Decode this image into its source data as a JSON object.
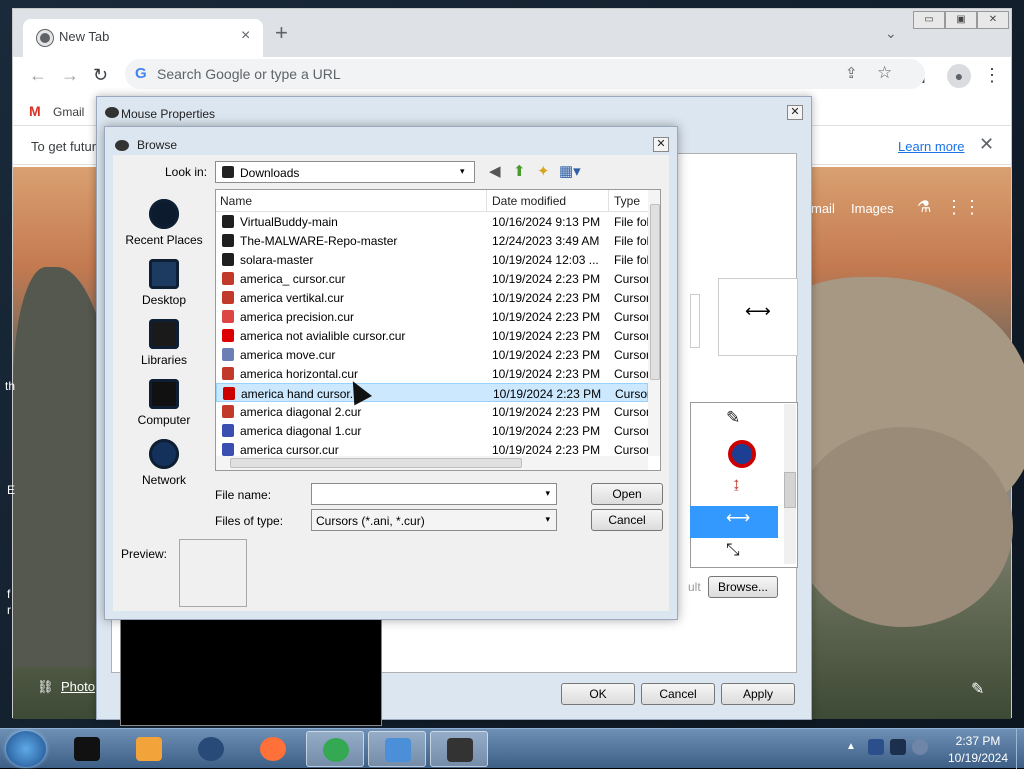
{
  "chrome": {
    "tab_title": "New Tab",
    "tab_close": "×",
    "new_tab": "+",
    "tab_search": "⌄",
    "window_buttons": {
      "minimize": "▭",
      "maximize": "▣",
      "close": "✕"
    },
    "back": "←",
    "forward": "→",
    "reload": "↻",
    "omnibox_placeholder": "Search Google or type a URL",
    "omnibox_g": "G",
    "share": "⇪",
    "star": "☆",
    "sidepanel": "▮",
    "profile": "●",
    "menu": "⋮",
    "bookmark_gmail_icon": "M",
    "bookmark_gmail": "Gmail",
    "infobar_text": "To get futur",
    "infobar_link": "Learn more",
    "infobar_close": "✕"
  },
  "ntp": {
    "gmail_link": "mail",
    "images_link": "Images",
    "flask": "⚗",
    "apps": "⋮⋮",
    "photo_link": "Photo",
    "photo_icon": "⛓",
    "edit": "✎",
    "left_fragments": [
      "th",
      "E",
      "f",
      "r"
    ]
  },
  "mouse_properties": {
    "title": "Mouse Properties",
    "close": "✕",
    "ok": "OK",
    "cancel": "Cancel",
    "apply": "Apply",
    "browse": "Browse...",
    "use_default_fragment": "ult",
    "cursor_preview_glyph": "⟷",
    "list_cursors": [
      "✎",
      "⃠",
      "↨",
      "⟷",
      "⤡"
    ]
  },
  "browse": {
    "title": "Browse",
    "close": "✕",
    "look_in_label": "Look in:",
    "look_in_value": "Downloads",
    "toolbar_icons": {
      "back": "◀",
      "up": "⬆",
      "new_folder": "✦",
      "views": "▦▾"
    },
    "places": [
      {
        "label": "Recent Places",
        "icon": "recent-places-icon"
      },
      {
        "label": "Desktop",
        "icon": "desktop-icon"
      },
      {
        "label": "Libraries",
        "icon": "libraries-icon"
      },
      {
        "label": "Computer",
        "icon": "computer-icon"
      },
      {
        "label": "Network",
        "icon": "network-icon"
      }
    ],
    "columns": [
      "Name",
      "Date modified",
      "Type"
    ],
    "files": [
      {
        "name": "VirtualBuddy-main",
        "date": "10/16/2024 9:13 PM",
        "type": "File fol",
        "icon": "folder",
        "color": "#1f1f1f"
      },
      {
        "name": "The-MALWARE-Repo-master",
        "date": "12/24/2023 3:49 AM",
        "type": "File fol",
        "icon": "folder",
        "color": "#1f1f1f"
      },
      {
        "name": "solara-master",
        "date": "10/19/2024 12:03 ...",
        "type": "File fol",
        "icon": "folder",
        "color": "#1f1f1f"
      },
      {
        "name": "america_ cursor.cur",
        "date": "10/19/2024 2:23 PM",
        "type": "Cursor",
        "icon": "cursor",
        "color": "#c0392b"
      },
      {
        "name": "america vertikal.cur",
        "date": "10/19/2024 2:23 PM",
        "type": "Cursor",
        "icon": "cursor",
        "color": "#c0392b"
      },
      {
        "name": "america precision.cur",
        "date": "10/19/2024 2:23 PM",
        "type": "Cursor",
        "icon": "cursor",
        "color": "#d44"
      },
      {
        "name": "america not avialible cursor.cur",
        "date": "10/19/2024 2:23 PM",
        "type": "Cursor",
        "icon": "cursor",
        "color": "#d00"
      },
      {
        "name": "america move.cur",
        "date": "10/19/2024 2:23 PM",
        "type": "Cursor",
        "icon": "cursor",
        "color": "#6b7fb5"
      },
      {
        "name": "america horizontal.cur",
        "date": "10/19/2024 2:23 PM",
        "type": "Cursor",
        "icon": "cursor",
        "color": "#c0392b"
      },
      {
        "name": "america hand cursor.",
        "date": "10/19/2024 2:23 PM",
        "type": "Cursor",
        "icon": "cursor",
        "color": "#c00"
      },
      {
        "name": "america diagonal 2.cur",
        "date": "10/19/2024 2:23 PM",
        "type": "Cursor",
        "icon": "cursor",
        "color": "#c0392b"
      },
      {
        "name": "america diagonal 1.cur",
        "date": "10/19/2024 2:23 PM",
        "type": "Cursor",
        "icon": "cursor",
        "color": "#3a4fb0"
      },
      {
        "name": "america cursor.cur",
        "date": "10/19/2024 2:23 PM",
        "type": "Cursor",
        "icon": "cursor",
        "color": "#3a4fb0"
      }
    ],
    "selected_row": "america hand cursor.",
    "file_name_label": "File name:",
    "file_name_value": "",
    "files_of_type_label": "Files of type:",
    "files_of_type_value": "Cursors (*.ani, *.cur)",
    "open": "Open",
    "cancel": "Cancel",
    "preview_label": "Preview:",
    "dropdown": "▾"
  },
  "taskbar": {
    "apps": [
      {
        "name": "taskbar-app-1",
        "color": "#111"
      },
      {
        "name": "taskbar-app-media",
        "color": "#f2a33a"
      },
      {
        "name": "taskbar-app-3",
        "color": "#274a78"
      },
      {
        "name": "taskbar-firefox",
        "color": "#ff7139"
      },
      {
        "name": "taskbar-chrome",
        "color": "#34a853"
      },
      {
        "name": "taskbar-users",
        "color": "#4a8fd8"
      },
      {
        "name": "taskbar-mouse",
        "color": "#333"
      }
    ],
    "tray_arrow": "▲",
    "time": "2:37 PM",
    "date": "10/19/2024"
  },
  "colors": {
    "accent": "#1a73e8",
    "selection": "#3399ff",
    "taskbar": "#3d5f86"
  }
}
